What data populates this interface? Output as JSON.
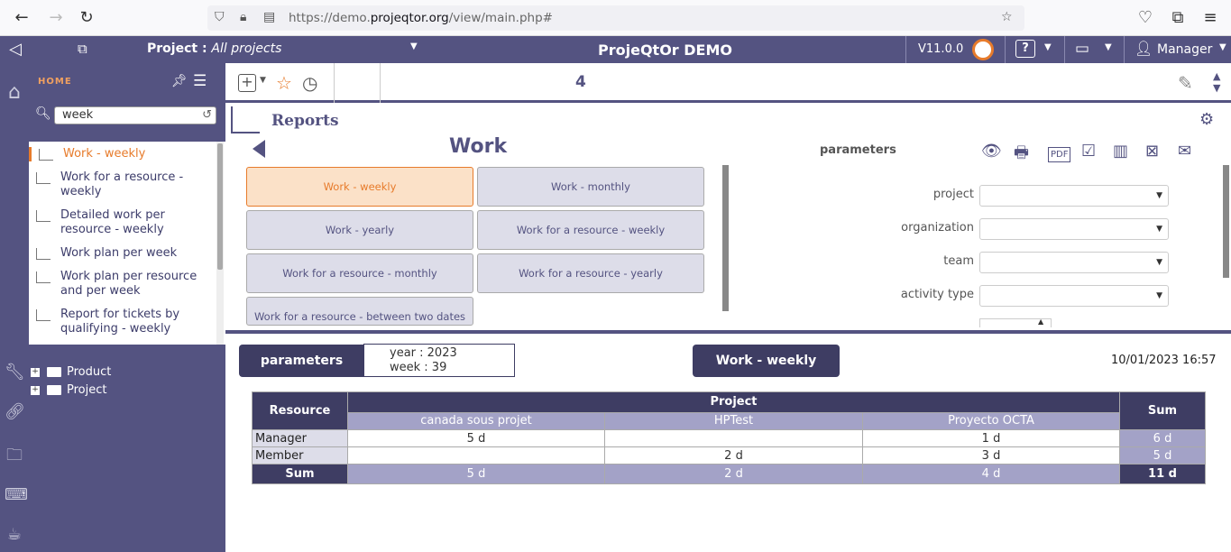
{
  "browser": {
    "url_prefix": "https://demo.",
    "url_domain": "projeqtor.org",
    "url_path": "/view/main.php#"
  },
  "app": {
    "project_label": "Project :",
    "project_value": "All projects",
    "title": "ProjeQtOr DEMO",
    "version": "V11.0.0",
    "help": "?",
    "user": "Manager"
  },
  "side": {
    "header": "HOME",
    "search_value": "week",
    "items": [
      {
        "label": "Work - weekly"
      },
      {
        "label": "Work for a resource - weekly"
      },
      {
        "label": "Detailed work per resource - weekly"
      },
      {
        "label": "Work plan per week"
      },
      {
        "label": "Work plan per resource and per week"
      },
      {
        "label": "Report for tickets by qualifying - weekly"
      }
    ],
    "tree": [
      {
        "label": "Product"
      },
      {
        "label": "Project"
      }
    ]
  },
  "toolbar": {
    "count": "4"
  },
  "reports": {
    "title": "Reports",
    "category": "Work",
    "buttons": [
      {
        "label": "Work - weekly"
      },
      {
        "label": "Work - monthly"
      },
      {
        "label": "Work - yearly"
      },
      {
        "label": "Work for a resource - weekly"
      },
      {
        "label": "Work for a resource - monthly"
      },
      {
        "label": "Work for a resource - yearly"
      },
      {
        "label": "Work for a resource - between two dates"
      }
    ]
  },
  "parameters": {
    "header": "parameters",
    "fields": [
      {
        "label": "project",
        "value": ""
      },
      {
        "label": "organization",
        "value": ""
      },
      {
        "label": "team",
        "value": ""
      },
      {
        "label": "activity type",
        "value": ""
      }
    ]
  },
  "result": {
    "params_label": "parameters",
    "year_line": "year : 2023",
    "week_line": "week : 39",
    "report_name": "Work - weekly",
    "timestamp": "10/01/2023 16:57",
    "table": {
      "resource_header": "Resource",
      "project_header": "Project",
      "sum_header": "Sum",
      "projects": [
        "canada sous projet",
        "HPTest",
        "Proyecto OCTA"
      ],
      "rows": [
        {
          "name": "Manager",
          "values": [
            "5 d",
            "",
            "1 d"
          ],
          "sum": "6 d"
        },
        {
          "name": "Member",
          "values": [
            "",
            "2 d",
            "3 d"
          ],
          "sum": "5 d"
        }
      ],
      "total_label": "Sum",
      "totals": [
        "5 d",
        "2 d",
        "4 d"
      ],
      "grand_total": "11 d"
    }
  }
}
